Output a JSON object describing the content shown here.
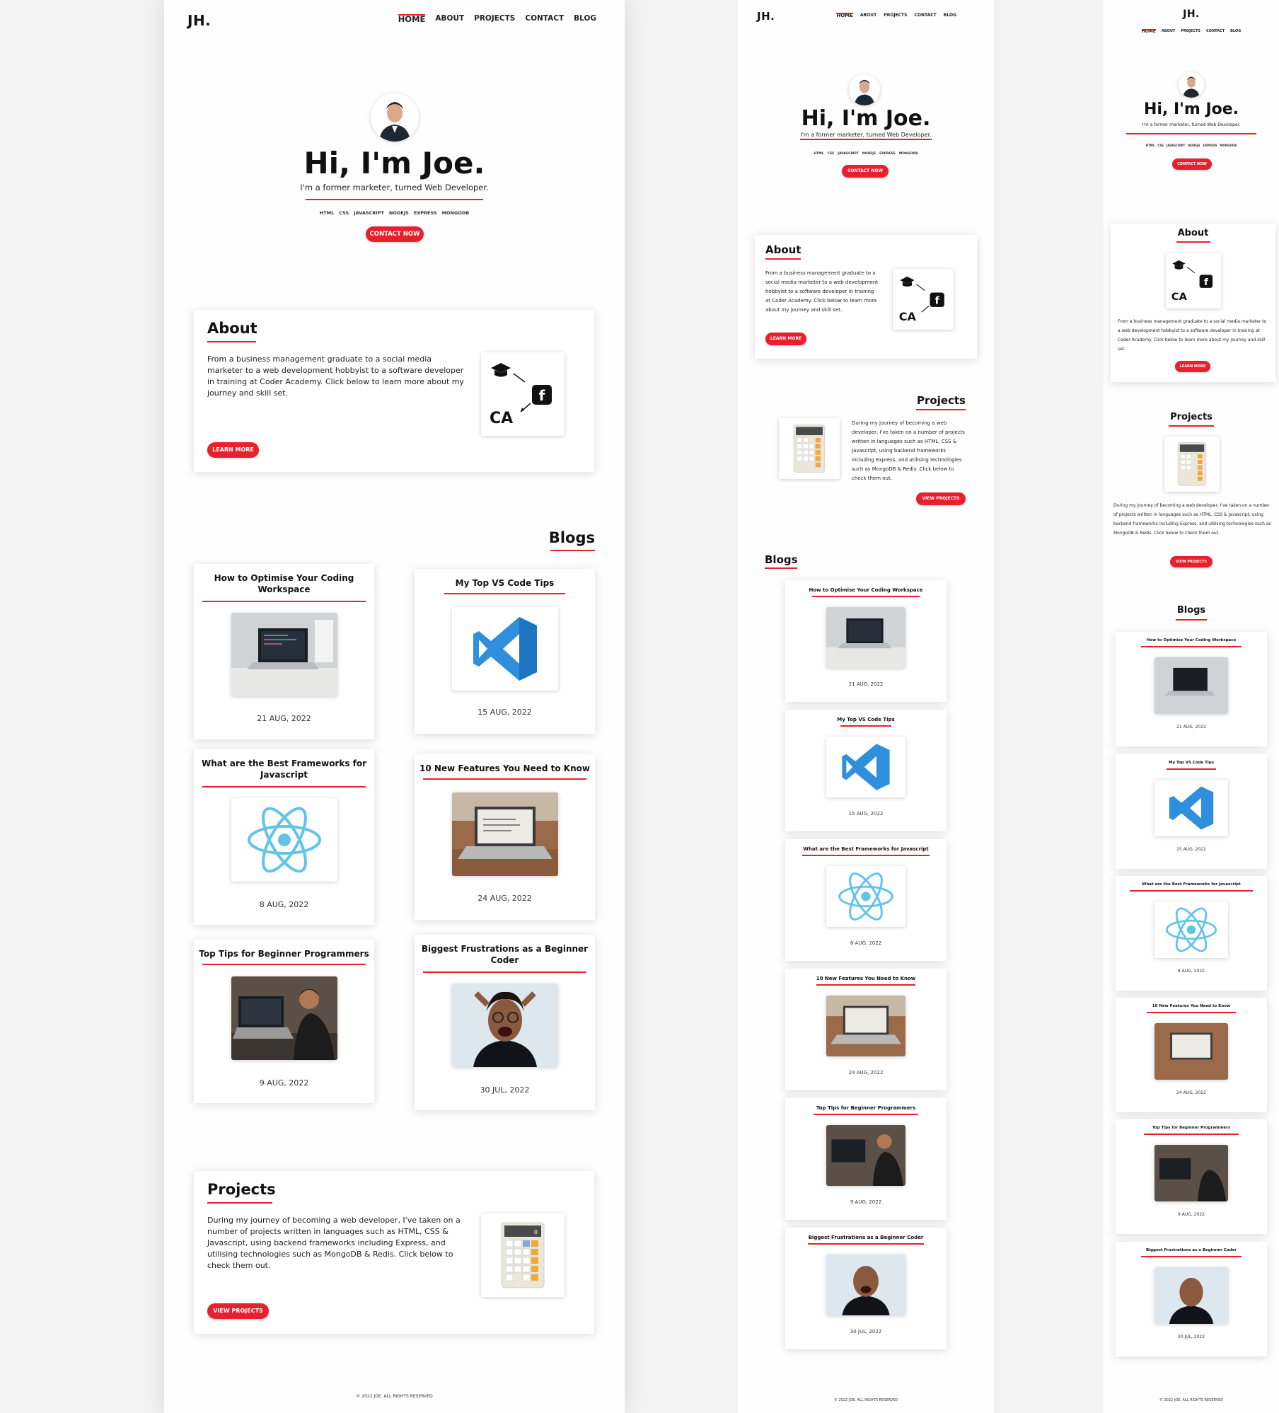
{
  "logo": "JH.",
  "nav": [
    "Home",
    "About",
    "Projects",
    "Contact",
    "Blog"
  ],
  "hero": {
    "title": "Hi, I'm Joe.",
    "subtitle": "I'm a former marketer, turned Web Developer.",
    "skills": [
      "HTML",
      "CSS",
      "JAVASCRIPT",
      "NODEJS",
      "EXPRESS",
      "MONGODB"
    ],
    "cta": "Contact Now"
  },
  "about": {
    "title": "About",
    "text": "From a business management graduate to a social media marketer to a web development hobbyist to a software developer in training at Coder Academy. Click below to learn more about my journey and skill set.",
    "button": "Learn More",
    "image_caption": "CA"
  },
  "projects": {
    "title": "Projects",
    "text": "During my journey of becoming a web developer, I've taken on a number of projects written in languages such as HTML, CSS & Javascript, using backend frameworks including Express, and utilising technologies such as MongoDB & Redis. Click below to check them out.",
    "button": "View Projects",
    "calc_display": "0"
  },
  "blogs": {
    "title": "Blogs",
    "posts": [
      {
        "title": "How to Optimise Your Coding Workspace",
        "date": "21 AUG, 2022",
        "image": "laptop-workspace"
      },
      {
        "title": "My Top VS Code Tips",
        "date": "15 AUG, 2022",
        "image": "vscode-logo"
      },
      {
        "title": "What are the Best Frameworks for Javascript",
        "date": "8 AUG, 2022",
        "image": "react-logo"
      },
      {
        "title": "10 New Features You Need to Know",
        "date": "24 AUG, 2022",
        "image": "laptop-desk"
      },
      {
        "title": "Top Tips for Beginner Programmers",
        "date": "9 AUG, 2022",
        "image": "programmer-laptop"
      },
      {
        "title": "Biggest Frustrations as a Beginner Coder",
        "date": "30 JUL, 2022",
        "image": "frustrated-coder"
      }
    ]
  },
  "footer": "© 2022 JOE. ALL RIGHTS RESERVED",
  "colors": {
    "accent": "#e8202d",
    "background": "#fefefe"
  }
}
